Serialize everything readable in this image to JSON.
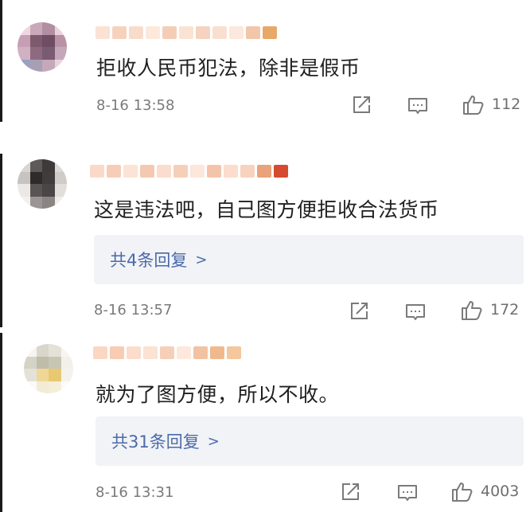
{
  "comments": [
    {
      "text": "拒收人民币犯法，除非是假币",
      "time": "8-16 13:58",
      "likes": "112",
      "replies_label": null,
      "avatar_colors": [
        "#efd7e2",
        "#c9a9b9",
        "#b38ea3",
        "#ead3dd",
        "#c79fb4",
        "#7e5a6e",
        "#6f4d62",
        "#b893a6",
        "#d0b1c2",
        "#8e6a80",
        "#7a5b72",
        "#c5a7ba",
        "#9aa0c0",
        "#a89fb4",
        "#c4a8bb",
        "#e8d4dd"
      ],
      "name_colors": [
        "#fbe2d4",
        "#f6d2bd",
        "#f8dccb",
        "#fde9dc",
        "#f4cdb6",
        "#fbe3d3",
        "#f5d3bf",
        "#f9dfcf",
        "#fce8dc",
        "#f2c6a8",
        "#e8a868"
      ]
    },
    {
      "text": "这是违法吧，自己图方便拒收合法货币",
      "time": "8-16 13:57",
      "likes": "172",
      "replies_label": "共4条回复",
      "avatar_colors": [
        "#d8d5d2",
        "#5e5a58",
        "#3e3a39",
        "#dcd8d6",
        "#c7c3c0",
        "#2f2b2a",
        "#403c3b",
        "#cfcbc8",
        "#ebe8e6",
        "#5a5553",
        "#4a4645",
        "#e2dedb",
        "#f3f1ef",
        "#9b9694",
        "#8a8583",
        "#f0edeb"
      ],
      "name_colors": [
        "#fbd9c8",
        "#f7cdb8",
        "#fce3d6",
        "#f5c9b1",
        "#fbdccd",
        "#f6cfb9",
        "#fde6da",
        "#f4c4aa",
        "#fbdccd",
        "#f7d2bf",
        "#e9a27a",
        "#d64a2f"
      ]
    },
    {
      "text": "就为了图方便，所以不收。",
      "time": "8-16 13:31",
      "likes": "4003",
      "replies_label": "共31条回复",
      "avatar_colors": [
        "#f6f4ef",
        "#d9d6cc",
        "#e4e1d8",
        "#f7f5f0",
        "#d4d3c5",
        "#bfbca9",
        "#c8c5b3",
        "#f2f0ea",
        "#e3e2d8",
        "#f1d796",
        "#e8c96f",
        "#f4f2ec",
        "#fbfaf7",
        "#f2ecd6",
        "#f5efd9",
        "#fcfbf8"
      ],
      "name_colors": [
        "#fbd7c3",
        "#f8cbb3",
        "#fcdccb",
        "#fbe2d3",
        "#f6cfb8",
        "#fde8dd",
        "#f3c2a2",
        "#f0b98d",
        "#f4c79c"
      ]
    }
  ]
}
